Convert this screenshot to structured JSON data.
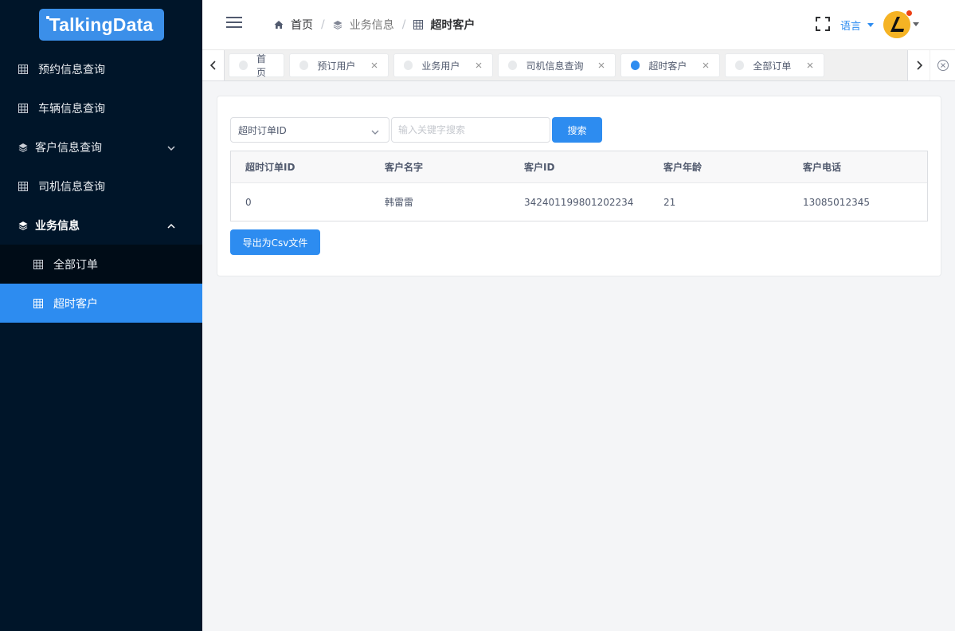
{
  "logo": {
    "text": "TalkingData"
  },
  "sidebar": {
    "items": [
      {
        "label": "预约信息查询"
      },
      {
        "label": "车辆信息查询"
      },
      {
        "label": "客户信息查询"
      },
      {
        "label": "司机信息查询"
      },
      {
        "label": "业务信息"
      },
      {
        "label": "全部订单"
      },
      {
        "label": "超时客户"
      }
    ]
  },
  "breadcrumb": {
    "home": "首页",
    "parent": "业务信息",
    "current": "超时客户"
  },
  "header": {
    "language": "语言"
  },
  "tabs": [
    {
      "label": "首页"
    },
    {
      "label": "预订用户"
    },
    {
      "label": "业务用户"
    },
    {
      "label": "司机信息查询"
    },
    {
      "label": "超时客户"
    },
    {
      "label": "全部订单"
    }
  ],
  "filter": {
    "field_selected": "超时订单ID",
    "search_placeholder": "输入关键字搜索",
    "search_label": "搜索"
  },
  "table": {
    "columns": [
      "超时订单ID",
      "客户名字",
      "客户ID",
      "客户年龄",
      "客户电话"
    ],
    "rows": [
      [
        "0",
        "韩雷雷",
        "342401199801202234",
        "21",
        "13085012345"
      ]
    ]
  },
  "export": {
    "label": "导出为Csv文件"
  },
  "colors": {
    "sidebar_bg": "#001529",
    "accent": "#2d8cf0"
  }
}
